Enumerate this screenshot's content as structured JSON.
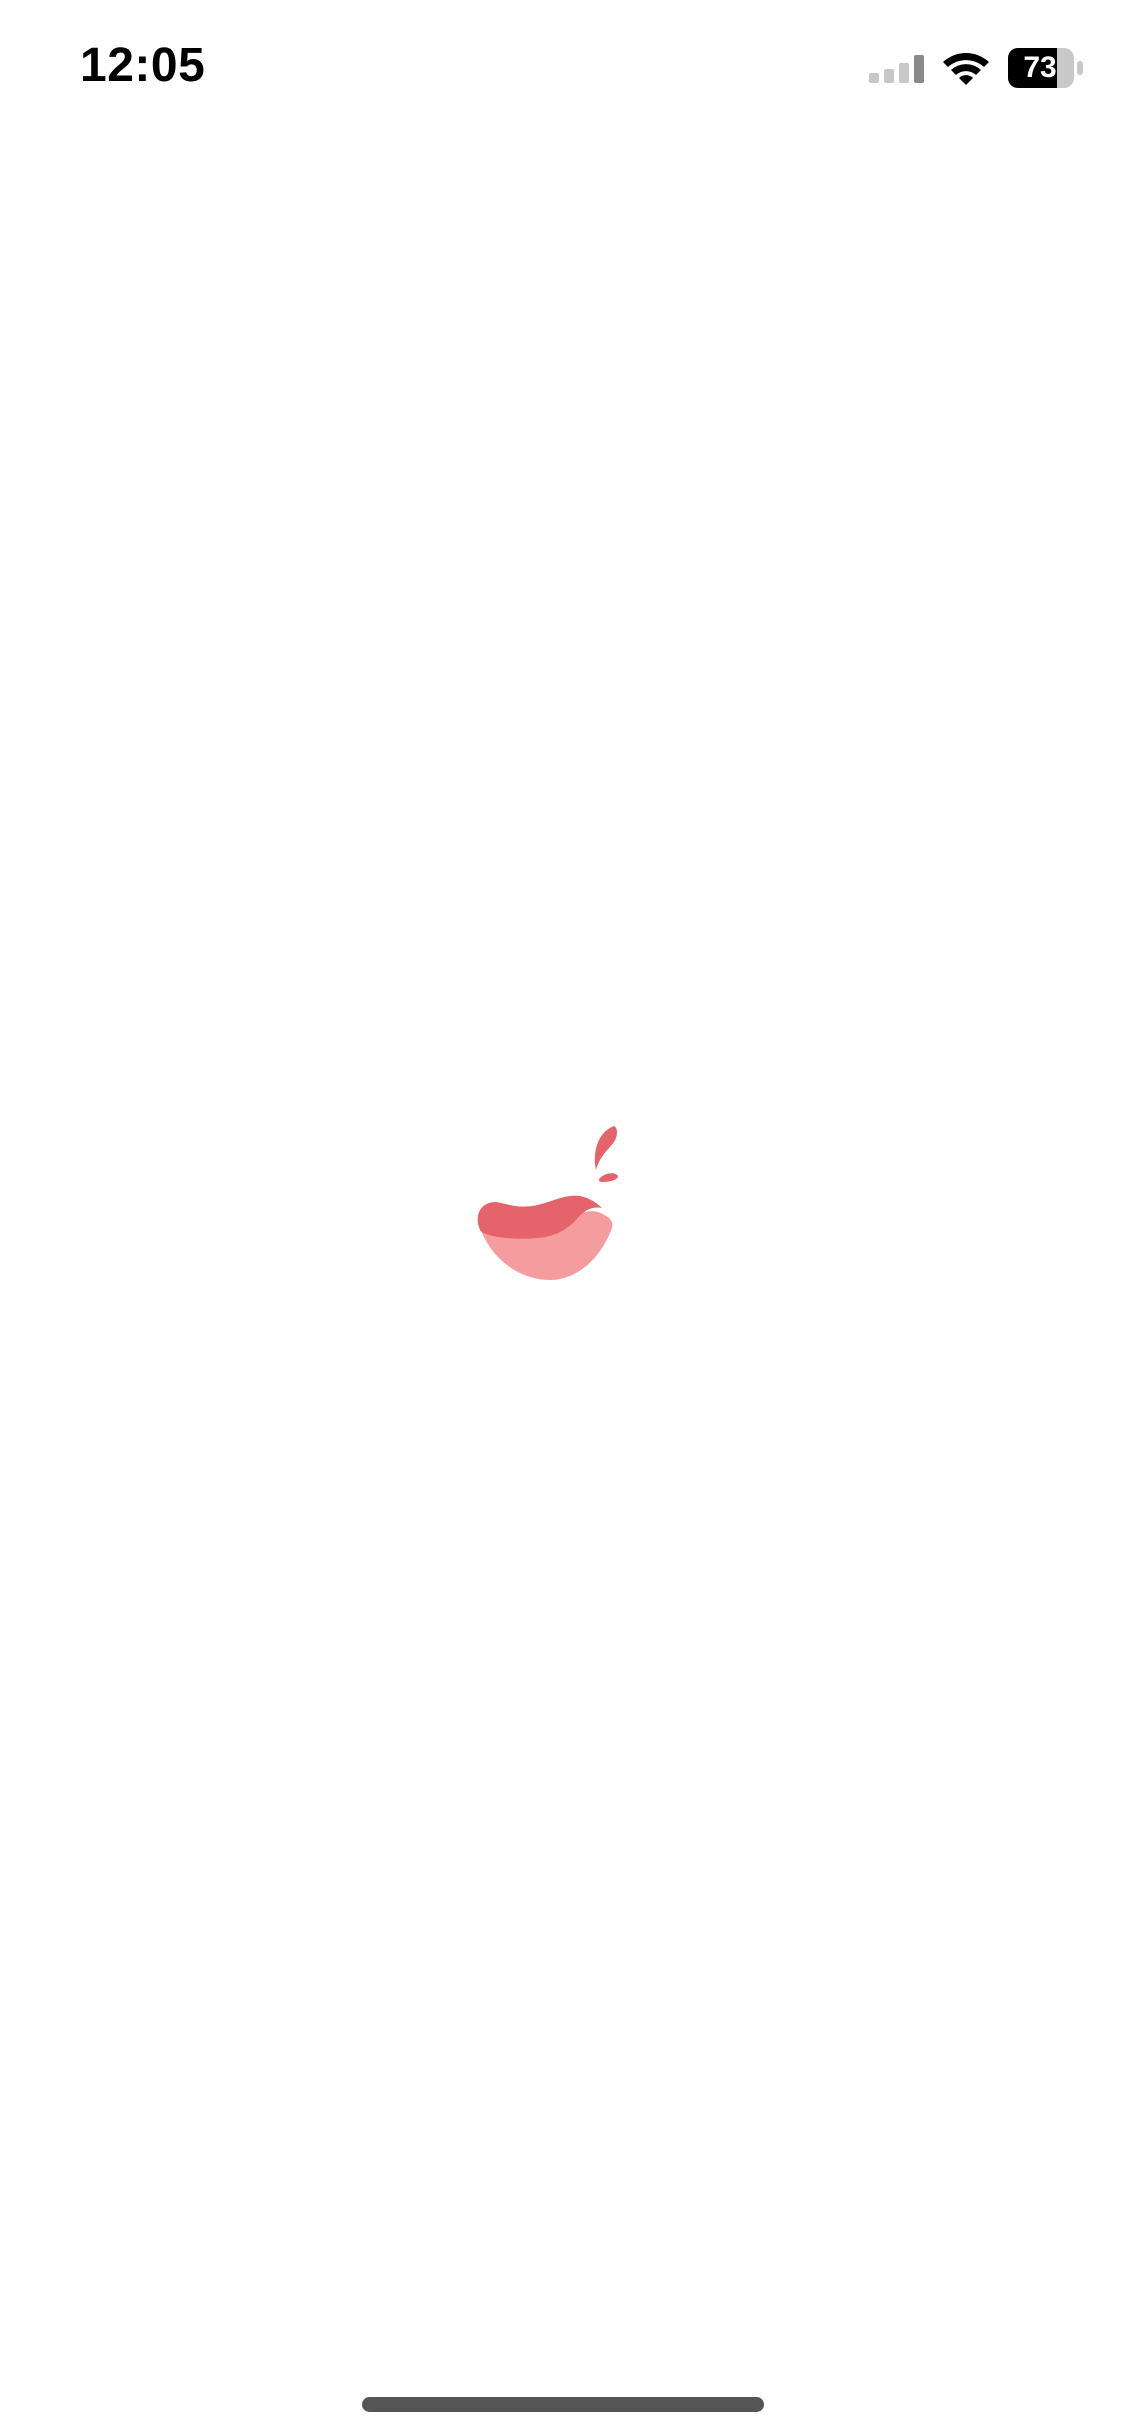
{
  "status_bar": {
    "time": "12:05",
    "battery_percent": "73",
    "signal_bars_active": 1,
    "signal_bars_total": 4
  },
  "icons": {
    "signal": "cellular-signal-icon",
    "wifi": "wifi-icon",
    "battery": "battery-icon",
    "logo": "app-logo-bowl-icon"
  },
  "colors": {
    "background": "#ffffff",
    "logo_dark": "#e5636a",
    "logo_light": "#f59c9e",
    "home_indicator": "#555555"
  }
}
